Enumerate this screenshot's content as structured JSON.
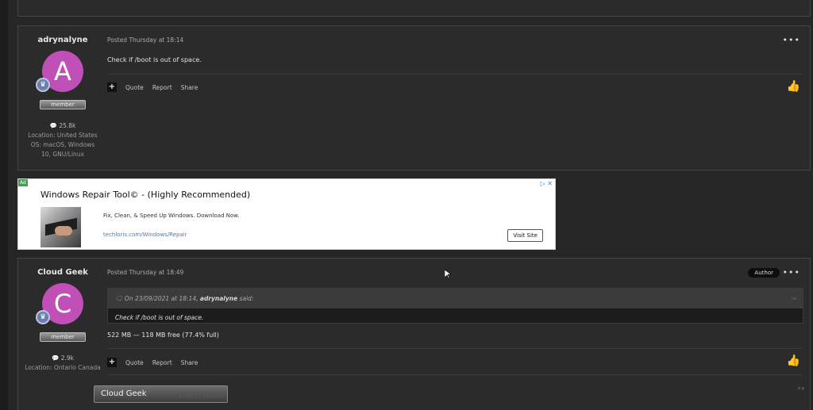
{
  "posts": [
    {
      "author": "adrynalyne",
      "avatar_letter": "A",
      "avatar_color": "#c050b8",
      "role": "member",
      "reputation": "25.8k",
      "location": "Location: United States",
      "os": "OS: macOS, Windows 10, GNU/Linux",
      "posted": "Posted Thursday at 18:14",
      "content": "Check if /boot is out of space.",
      "actions": {
        "quote": "Quote",
        "report": "Report",
        "share": "Share"
      }
    },
    {
      "author": "Cloud Geek",
      "avatar_letter": "C",
      "avatar_color": "#c050b8",
      "role": "member",
      "reputation": "2.9k",
      "location": "Location: Ontario Canada",
      "posted": "Posted Thursday at 18:49",
      "author_tag": "Author",
      "quote": {
        "prefix": "On 23/09/2021 at 18:14,",
        "author": "adrynalyne",
        "suffix": "said:",
        "text": "Check if /boot is out of space."
      },
      "content": "522 MB — 118 MB free (77.4% full)",
      "actions": {
        "quote": "Quote",
        "report": "Report",
        "share": "Share"
      },
      "signature": {
        "name": "Cloud Geek",
        "ghost": "member"
      }
    }
  ],
  "ad": {
    "tag": "Ad",
    "title": "Windows Repair Tool© - (Highly Recommended)",
    "description": "Fix, Clean, & Speed Up Windows. Download Now.",
    "url": "techloris.com/Windows/Repair",
    "cta": "Visit Site"
  }
}
